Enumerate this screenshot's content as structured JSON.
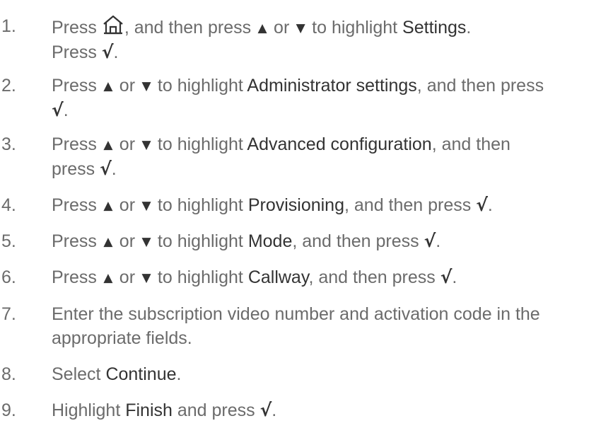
{
  "steps": [
    {
      "number": "1.",
      "line1_a": "Press ",
      "line1_b": ", and then press ",
      "line1_c": " or ",
      "line1_d": " to highlight ",
      "line1_bold": "Settings",
      "line1_e": ".",
      "line2_a": "Press ",
      "line2_check": "√",
      "line2_e": "."
    },
    {
      "number": "2.",
      "line1_a": "Press ",
      "line1_c": " or ",
      "line1_d": " to highlight ",
      "line1_bold": "Administrator settings",
      "line1_e": ", and then press",
      "line2_check": "√",
      "line2_e": "."
    },
    {
      "number": "3.",
      "line1_a": "Press ",
      "line1_c": " or ",
      "line1_d": " to highlight ",
      "line1_bold": "Advanced configuration",
      "line1_e": ", and then",
      "line2_a": "press ",
      "line2_check": "√",
      "line2_e": "."
    },
    {
      "number": "4.",
      "line1_a": "Press ",
      "line1_c": " or ",
      "line1_d": " to highlight ",
      "line1_bold": "Provisioning",
      "line1_e": ", and then press ",
      "line1_check": "√",
      "line1_f": "."
    },
    {
      "number": "5.",
      "line1_a": "Press ",
      "line1_c": " or ",
      "line1_d": " to highlight ",
      "line1_bold": "Mode",
      "line1_e": ", and then press ",
      "line1_check": "√",
      "line1_f": "."
    },
    {
      "number": "6.",
      "line1_a": "Press ",
      "line1_c": " or ",
      "line1_d": " to highlight ",
      "line1_bold": "Callway",
      "line1_e": ", and then press ",
      "line1_check": "√",
      "line1_f": "."
    },
    {
      "number": "7.",
      "line1": "Enter the subscription video number and activation code in the",
      "line2": "appropriate fields."
    },
    {
      "number": "8.",
      "line1_a": "Select ",
      "line1_bold": "Continue",
      "line1_e": "."
    },
    {
      "number": "9.",
      "line1_a": "Highlight ",
      "line1_bold": "Finish",
      "line1_e": " and press ",
      "line1_check": "√",
      "line1_f": "."
    }
  ],
  "icons": {
    "home": "home-icon",
    "up": "up-arrow-icon",
    "down": "down-arrow-icon",
    "up_glyph": "▲",
    "down_glyph": "▼"
  }
}
